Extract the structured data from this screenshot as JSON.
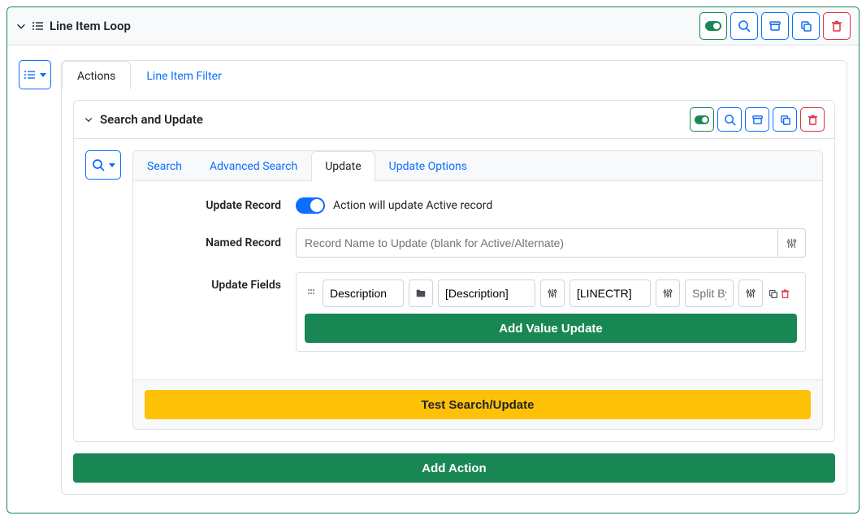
{
  "outer": {
    "title": "Line Item Loop"
  },
  "tabs": {
    "actions": "Actions",
    "filter": "Line Item Filter"
  },
  "action": {
    "title": "Search and Update"
  },
  "subtabs": {
    "search": "Search",
    "advanced": "Advanced Search",
    "update": "Update",
    "options": "Update Options"
  },
  "form": {
    "updateRecordLabel": "Update Record",
    "updateRecordHint": "Action will update Active record",
    "namedRecordLabel": "Named Record",
    "namedRecordPlaceholder": "Record Name to Update (blank for Active/Alternate)",
    "updateFieldsLabel": "Update Fields"
  },
  "fieldRow": {
    "field": "Description",
    "value1": "[Description]",
    "value2": "[LINECTR]",
    "splitPlaceholder": "Split By"
  },
  "buttons": {
    "addValue": "Add Value Update",
    "test": "Test Search/Update",
    "addAction": "Add Action"
  }
}
